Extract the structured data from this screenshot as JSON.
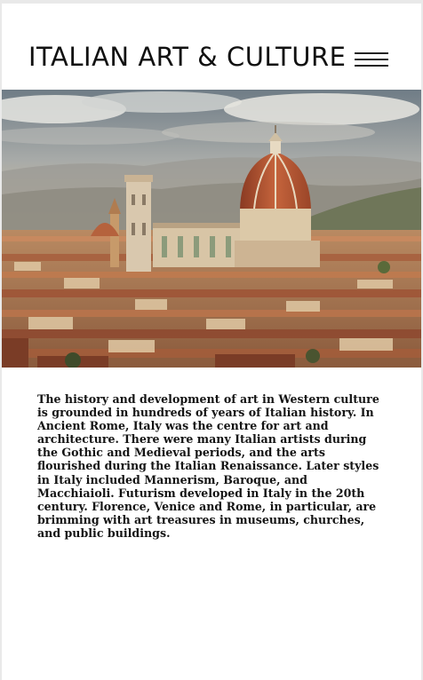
{
  "header": {
    "title": "ITALIAN ART & CULTURE",
    "menu_icon": "hamburger-menu-icon"
  },
  "hero": {
    "subject": "Florence skyline with the cathedral dome"
  },
  "article": {
    "body": "The history and development of art in Western culture is grounded in hundreds of years of Italian history. In Ancient Rome, Italy was the centre for art and architecture. There were many Italian artists during the Gothic and Medieval periods, and the arts flourished during the Italian Renaissance. Later styles in Italy included Mannerism, Baroque, and Macchiaioli. Futurism developed in Italy in the 20th century. Florence, Venice and Rome, in particular, are brimming with art treasures in museums, churches, and public buildings."
  },
  "colors": {
    "page_background": "#ffffff",
    "outer_background": "#e9e9e9",
    "text": "#141414",
    "terracotta": "#b65a36"
  }
}
